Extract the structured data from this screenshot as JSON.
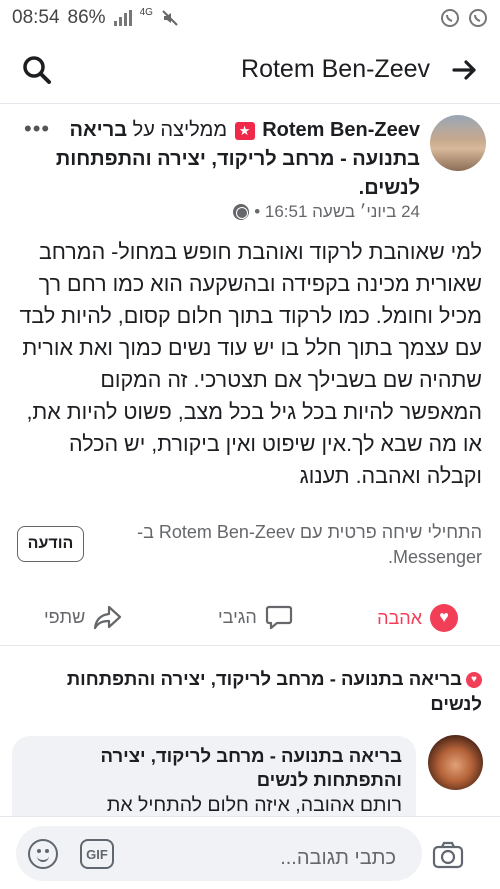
{
  "status_bar": {
    "time": "08:54",
    "battery": "86%",
    "network": "4G"
  },
  "header": {
    "title": "Rotem Ben-Zeev"
  },
  "post": {
    "author": "Rotem Ben-Zeev",
    "recommends_label": "ממליצה על",
    "page_name": "בריאה בתנועה - מרחב לריקוד, יצירה והתפתחות לנשים.",
    "timestamp": "24 ביוני׳ בשעה 16:51 •",
    "body": "למי שאוהבת לרקוד ואוהבת חופש במחול- המרחב שאורית מכינה בקפידה ובהשקעה הוא כמו רחם רך מכיל וחומל. כמו לרקוד בתוך חלום קסום, להיות לבד עם עצמך בתוך חלל בו יש עוד נשים כמוך ואת אורית שתהיה שם בשבילך אם תצטרכי. זה המקום המאפשר להיות בכל גיל בכל מצב, פשוט להיות את, או מה שבא לך.אין שיפוט ואין ביקורת, יש הכלה וקבלה ואהבה. תענוג",
    "messenger_text": "התחילי שיחה פרטית עם Rotem Ben-Zeev ב-Messenger.",
    "message_button": "הודעה"
  },
  "actions": {
    "love": "אהבה",
    "comment": "הגיבי",
    "share": "שתפי"
  },
  "reaction_line": "בריאה בתנועה - מרחב לריקוד, יצירה והתפתחות לנשים",
  "comment": {
    "author": "בריאה בתנועה - מרחב לריקוד, יצירה והתפתחות לנשים",
    "text": "רותם אהובה, איזה חלום להתחיל את"
  },
  "composer": {
    "placeholder": "כתבי תגובה...",
    "gif_label": "GIF"
  },
  "colors": {
    "love": "#f33e58",
    "text": "#1c1e21",
    "secondary": "#65676b",
    "bubble": "#f0f2f5"
  }
}
